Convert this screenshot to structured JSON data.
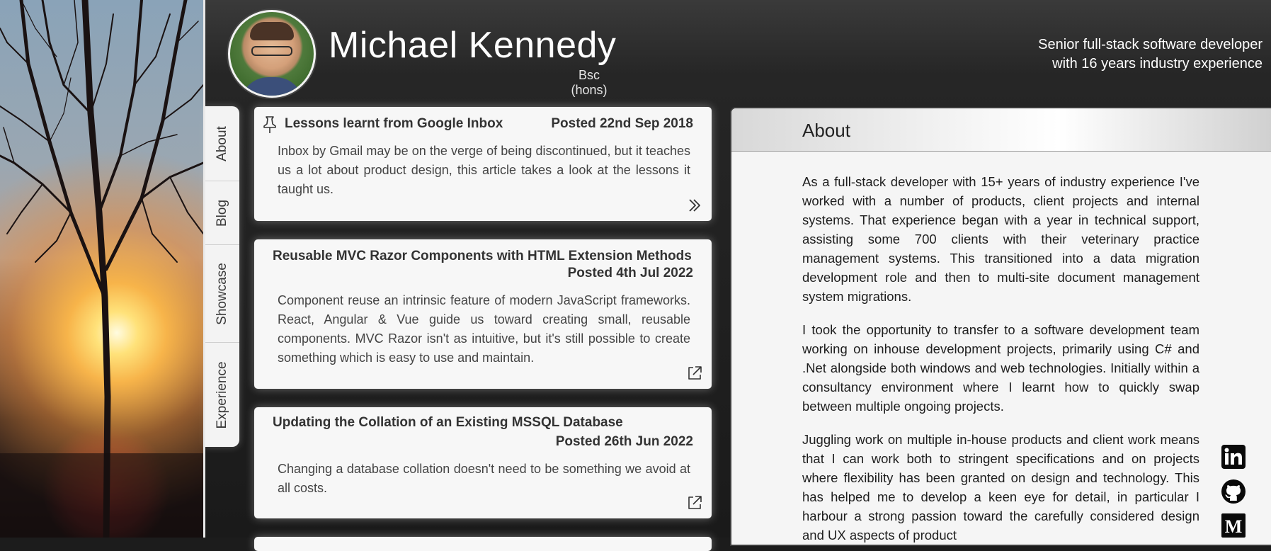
{
  "header": {
    "name": "Michael Kennedy",
    "degree": "Bsc (hons)",
    "tagline_line1": "Senior full-stack software developer",
    "tagline_line2": "with 16 years industry experience"
  },
  "tabs": [
    {
      "label": "About"
    },
    {
      "label": "Blog"
    },
    {
      "label": "Showcase"
    },
    {
      "label": "Experience"
    }
  ],
  "blog": {
    "posts": [
      {
        "title": "Lessons learnt from Google Inbox",
        "date": "Posted 22nd Sep 2018",
        "excerpt": "Inbox by Gmail may be on the verge of being discontinued, but it teaches us a lot about product design, this article takes a look at the lessons it taught us.",
        "pinned": true,
        "link_icon": "double-chevron-right-icon"
      },
      {
        "title": "Reusable MVC Razor Components with HTML Extension Methods",
        "date": "Posted 4th Jul 2022",
        "excerpt": "Component reuse an intrinsic feature of modern JavaScript frameworks. React, Angular & Vue guide us toward creating small, reusable components. MVC Razor isn't as intuitive, but it's still possible to create something which is easy to use and maintain.",
        "pinned": false,
        "link_icon": "external-link-icon"
      },
      {
        "title": "Updating the Collation of an Existing MSSQL Database",
        "date": "Posted 26th Jun 2022",
        "excerpt": "Changing a database collation doesn't need to be something we avoid at all costs.",
        "pinned": false,
        "link_icon": "external-link-icon"
      }
    ]
  },
  "about": {
    "title": "About",
    "paragraphs": [
      "As a full-stack developer with 15+ years of industry experience I've worked with a number of products, client projects and internal systems. That experience began with a year in technical support, assisting some 700 clients with their veterinary practice management systems. This transitioned into a data migration development role and then to multi-site document management system migrations.",
      "I took the opportunity to transfer to a software development team working on inhouse development projects, primarily using C# and .Net alongside both windows and web technologies. Initially within a consultancy environment where I learnt how to quickly swap between multiple ongoing projects.",
      "Juggling work on multiple in-house products and client work means that I can work both to stringent specifications and on projects where flexibility has been granted on design and technology. This has helped me to develop a keen eye for detail, in particular I harbour a strong passion toward the carefully considered design and UX aspects of product"
    ]
  },
  "social": [
    {
      "icon": "linkedin-icon"
    },
    {
      "icon": "github-icon"
    },
    {
      "icon": "medium-icon"
    }
  ],
  "colors": {
    "background": "#1c1c1c",
    "card": "#f7f7f7",
    "panel": "#f5f5f5",
    "text_light": "#ffffff"
  }
}
